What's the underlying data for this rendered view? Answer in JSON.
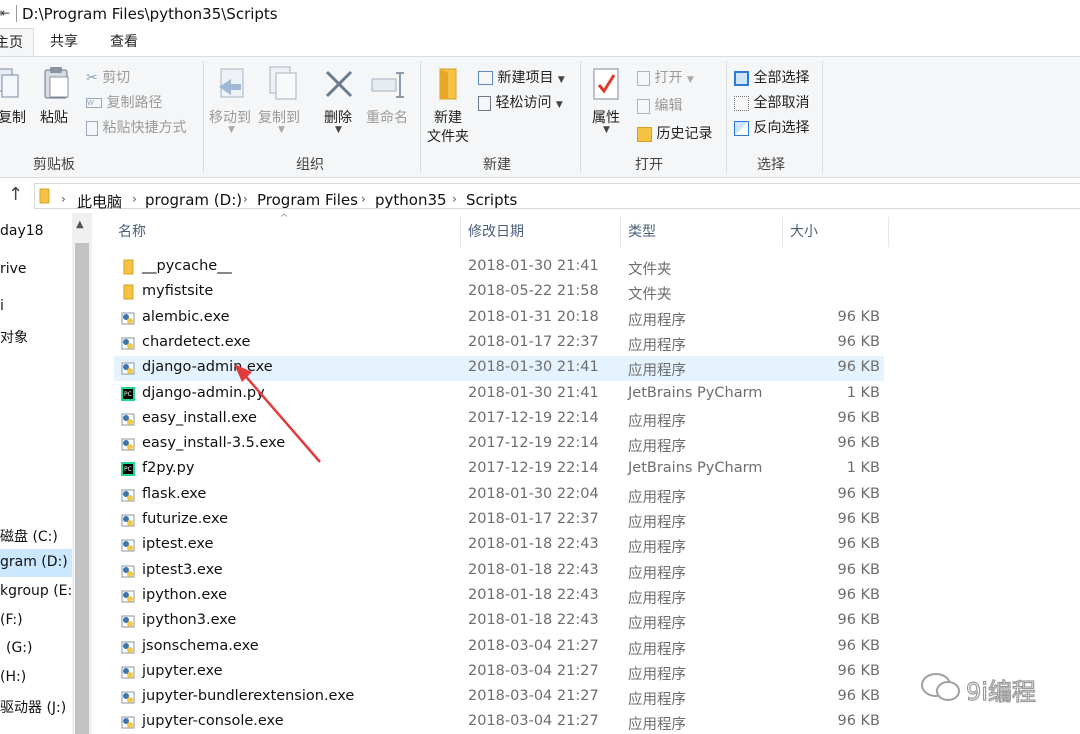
{
  "window": {
    "path": "D:\\Program Files\\python35\\Scripts"
  },
  "ribbon": {
    "tabs": [
      "主页",
      "共享",
      "查看"
    ],
    "clipboard": {
      "copy": "复制",
      "paste": "粘贴",
      "cut": "剪切",
      "copy_path": "复制路径",
      "paste_shortcut": "粘贴快捷方式",
      "label": "剪贴板"
    },
    "organize": {
      "move_to": "移动到",
      "copy_to": "复制到",
      "delete": "删除",
      "rename": "重命名",
      "label": "组织"
    },
    "new": {
      "new_folder_line1": "新建",
      "new_folder_line2": "文件夹",
      "new_item": "新建项目",
      "easy_access": "轻松访问",
      "label": "新建"
    },
    "open": {
      "properties": "属性",
      "open": "打开",
      "edit": "编辑",
      "history": "历史记录",
      "label": "打开"
    },
    "select": {
      "select_all": "全部选择",
      "select_none": "全部取消",
      "invert": "反向选择",
      "label": "选择"
    }
  },
  "address": {
    "crumbs": [
      "此电脑",
      "program (D:)",
      "Program Files",
      "python35",
      "Scripts"
    ]
  },
  "nav": {
    "items": [
      "day18",
      "rive",
      "i",
      "对象",
      "磁盘 (C:)",
      "gram (D:)",
      "kgroup (E:)",
      "(F:)",
      "(G:)",
      "(H:)",
      "驱动器 (J:)"
    ]
  },
  "columns": {
    "name": "名称",
    "date": "修改日期",
    "type": "类型",
    "size": "大小"
  },
  "files": [
    {
      "name": "__pycache__",
      "date": "2018-01-30 21:41",
      "type": "文件夹",
      "size": "",
      "icon": "folder-icon"
    },
    {
      "name": "myfistsite",
      "date": "2018-05-22 21:58",
      "type": "文件夹",
      "size": "",
      "icon": "folder-icon"
    },
    {
      "name": "alembic.exe",
      "date": "2018-01-31 20:18",
      "type": "应用程序",
      "size": "96 KB",
      "icon": "python-exe-icon"
    },
    {
      "name": "chardetect.exe",
      "date": "2018-01-17 22:37",
      "type": "应用程序",
      "size": "96 KB",
      "icon": "python-exe-icon"
    },
    {
      "name": "django-admin.exe",
      "date": "2018-01-30 21:41",
      "type": "应用程序",
      "size": "96 KB",
      "icon": "python-exe-icon"
    },
    {
      "name": "django-admin.py",
      "date": "2018-01-30 21:41",
      "type": "JetBrains PyCharm",
      "size": "1 KB",
      "icon": "pycharm-icon"
    },
    {
      "name": "easy_install.exe",
      "date": "2017-12-19 22:14",
      "type": "应用程序",
      "size": "96 KB",
      "icon": "python-exe-icon"
    },
    {
      "name": "easy_install-3.5.exe",
      "date": "2017-12-19 22:14",
      "type": "应用程序",
      "size": "96 KB",
      "icon": "python-exe-icon"
    },
    {
      "name": "f2py.py",
      "date": "2017-12-19 22:14",
      "type": "JetBrains PyCharm",
      "size": "1 KB",
      "icon": "pycharm-icon"
    },
    {
      "name": "flask.exe",
      "date": "2018-01-30 22:04",
      "type": "应用程序",
      "size": "96 KB",
      "icon": "python-exe-icon"
    },
    {
      "name": "futurize.exe",
      "date": "2018-01-17 22:37",
      "type": "应用程序",
      "size": "96 KB",
      "icon": "python-exe-icon"
    },
    {
      "name": "iptest.exe",
      "date": "2018-01-18 22:43",
      "type": "应用程序",
      "size": "96 KB",
      "icon": "python-exe-icon"
    },
    {
      "name": "iptest3.exe",
      "date": "2018-01-18 22:43",
      "type": "应用程序",
      "size": "96 KB",
      "icon": "python-exe-icon"
    },
    {
      "name": "ipython.exe",
      "date": "2018-01-18 22:43",
      "type": "应用程序",
      "size": "96 KB",
      "icon": "python-exe-icon"
    },
    {
      "name": "ipython3.exe",
      "date": "2018-01-18 22:43",
      "type": "应用程序",
      "size": "96 KB",
      "icon": "python-exe-icon"
    },
    {
      "name": "jsonschema.exe",
      "date": "2018-03-04 21:27",
      "type": "应用程序",
      "size": "96 KB",
      "icon": "python-exe-icon"
    },
    {
      "name": "jupyter.exe",
      "date": "2018-03-04 21:27",
      "type": "应用程序",
      "size": "96 KB",
      "icon": "python-exe-icon"
    },
    {
      "name": "jupyter-bundlerextension.exe",
      "date": "2018-03-04 21:27",
      "type": "应用程序",
      "size": "96 KB",
      "icon": "python-exe-icon"
    },
    {
      "name": "jupyter-console.exe",
      "date": "2018-03-04 21:27",
      "type": "应用程序",
      "size": "96 KB",
      "icon": "python-exe-icon"
    }
  ],
  "watermark": {
    "text": "9i编程"
  },
  "colors": {
    "accent": "#1979ca",
    "hover": "#e5f3ff",
    "selected": "#cce8ff",
    "arrow": "#e03c3c"
  }
}
